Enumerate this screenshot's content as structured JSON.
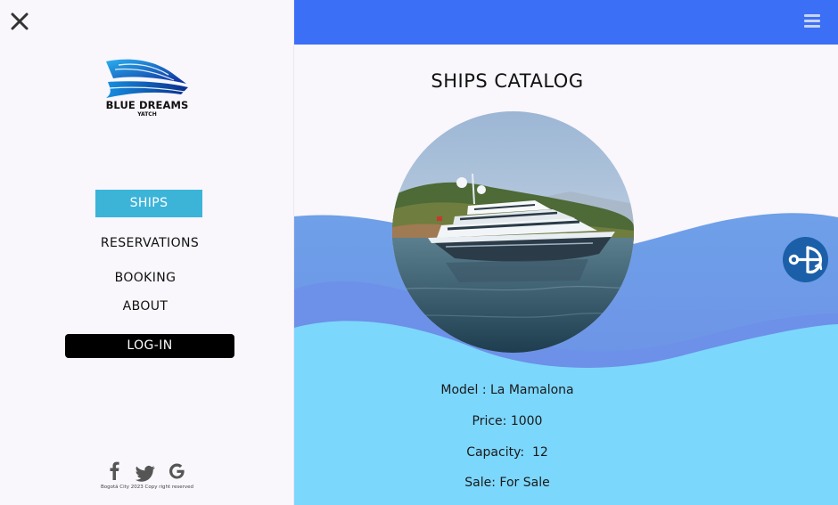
{
  "sidebar": {
    "brand": {
      "name": "BLUE DREAMS",
      "sub": "YATCH"
    },
    "nav": {
      "ships": "SHIPS",
      "reservations": "RESERVATIONS",
      "booking": "BOOKING",
      "about": "ABOUT"
    },
    "login_label": "LOG-IN",
    "social_icons": [
      "facebook-icon",
      "twitter-icon",
      "google-icon"
    ],
    "copyright": "Bogotá City 2023 Copy right reserved"
  },
  "main": {
    "title": "SHIPS CATALOG",
    "details": {
      "model": "Model : La Mamalona",
      "price": "Price: 1000",
      "capacity": "Capacity:  12",
      "sale": "Sale: For Sale"
    }
  },
  "colors": {
    "topbar": "#3b6ff5",
    "active_nav": "#3cb4d8",
    "login_button": "#000000",
    "wave_back": "#6c9ee6",
    "wave_front": "#7cd7fd",
    "anchor_button": "#1b5fa8"
  }
}
